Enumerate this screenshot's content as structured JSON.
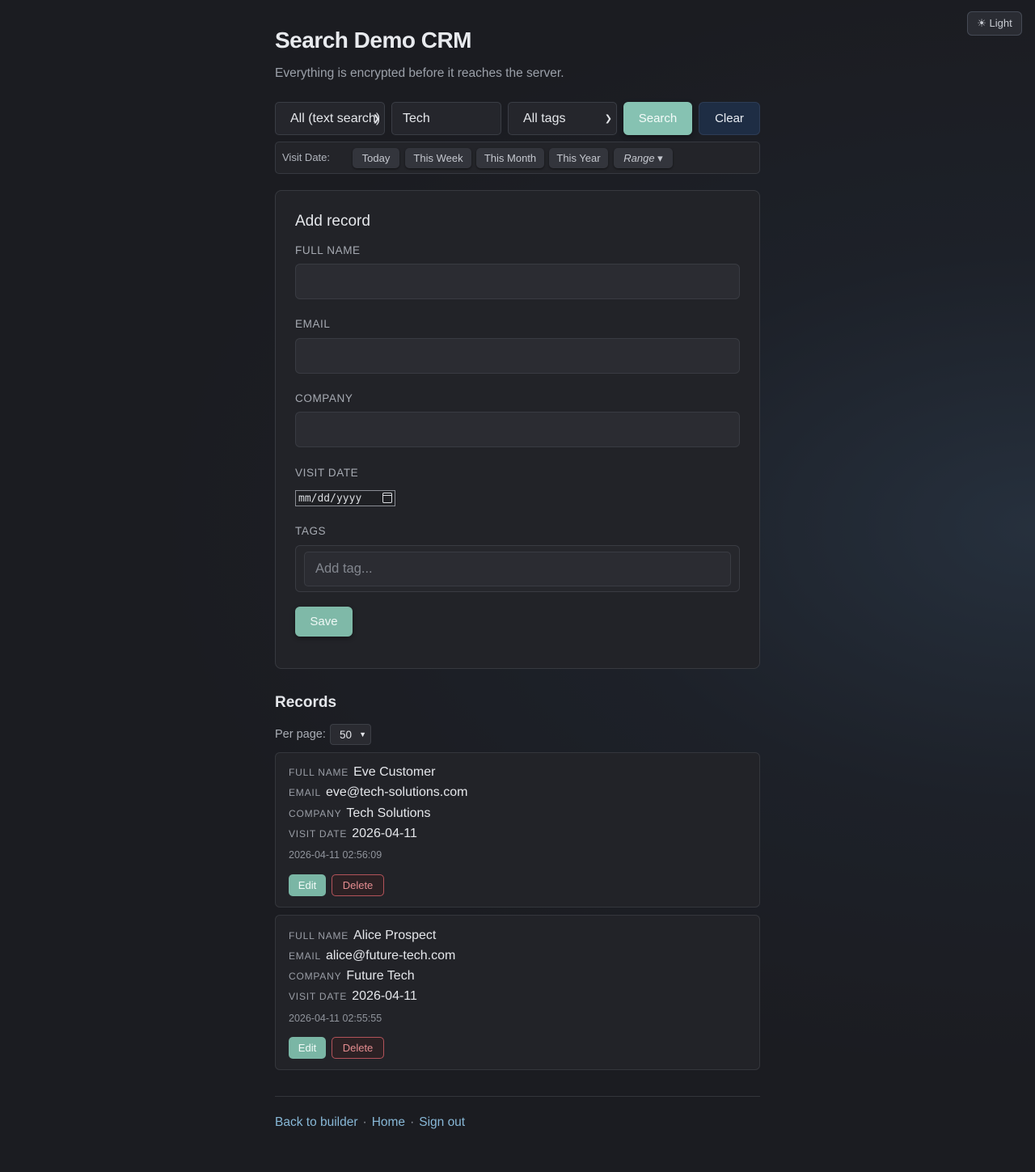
{
  "theme_toggle": {
    "icon": "sun-icon",
    "label": "☀ Light"
  },
  "header": {
    "title": "Search Demo CRM",
    "subtitle": "Everything is encrypted before it reaches the server."
  },
  "search": {
    "field_select": "All (text search)",
    "query_value": "Tech",
    "tags_select": "All tags",
    "search_label": "Search",
    "clear_label": "Clear"
  },
  "date_filter": {
    "label": "Visit Date:",
    "chips": [
      "Today",
      "This Week",
      "This Month",
      "This Year",
      "Range ▾"
    ]
  },
  "add_form": {
    "title": "Add record",
    "full_name_label": "FULL NAME",
    "email_label": "EMAIL",
    "company_label": "COMPANY",
    "visit_date_label": "VISIT DATE",
    "visit_date_placeholder": "mm/dd/yyyy",
    "tags_label": "TAGS",
    "tag_placeholder": "Add tag...",
    "save_label": "Save"
  },
  "records": {
    "title": "Records",
    "per_page_label": "Per page:",
    "per_page_value": "50",
    "items": [
      {
        "full_name_key": "FULL NAME",
        "full_name": "Eve Customer",
        "email_key": "EMAIL",
        "email": "eve@tech-solutions.com",
        "company_key": "COMPANY",
        "company": "Tech Solutions",
        "visit_date_key": "VISIT DATE",
        "visit_date": "2026-04-11",
        "timestamp": "2026-04-11 02:56:09",
        "edit_label": "Edit",
        "delete_label": "Delete"
      },
      {
        "full_name_key": "FULL NAME",
        "full_name": "Alice Prospect",
        "email_key": "EMAIL",
        "email": "alice@future-tech.com",
        "company_key": "COMPANY",
        "company": "Future Tech",
        "visit_date_key": "VISIT DATE",
        "visit_date": "2026-04-11",
        "timestamp": "2026-04-11 02:55:55",
        "edit_label": "Edit",
        "delete_label": "Delete"
      }
    ]
  },
  "footer": {
    "links": [
      "Back to builder",
      "Home",
      "Sign out"
    ],
    "separator": "·"
  },
  "colors": {
    "accent": "#86c2b2",
    "danger": "#b3535a",
    "link": "#87b7d6",
    "background": "#1b1c21"
  }
}
